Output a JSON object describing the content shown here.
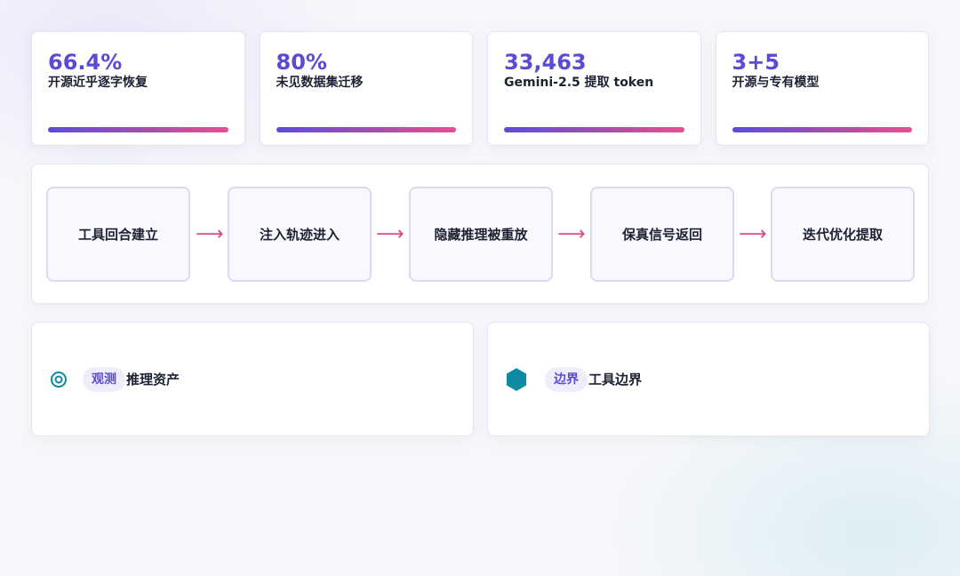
{
  "stats": [
    {
      "value": "66.4%",
      "label": "开源近乎逐字恢复",
      "progress": 1.0
    },
    {
      "value": "80%",
      "label": "未见数据集迁移",
      "progress": 1.0
    },
    {
      "value": "33,463",
      "label": "Gemini-2.5 提取 token",
      "progress": 1.0
    },
    {
      "value": "3+5",
      "label": "开源与专有模型",
      "progress": 1.0
    }
  ],
  "flow": {
    "steps": [
      "工具回合建立",
      "注入轨迹进入",
      "隐藏推理被重放",
      "保真信号返回",
      "迭代优化提取"
    ],
    "arrow": "⟶"
  },
  "panels": [
    {
      "icon": "target-icon",
      "tag": "观测",
      "title": "推理资产"
    },
    {
      "icon": "hexagon-icon",
      "tag": "边界",
      "title": "工具边界"
    }
  ],
  "colors": {
    "accent": "#5a4bd4",
    "gradient_start": "#5b4dd6",
    "gradient_end": "#e3508e",
    "hexagon": "#0e8aa3"
  }
}
